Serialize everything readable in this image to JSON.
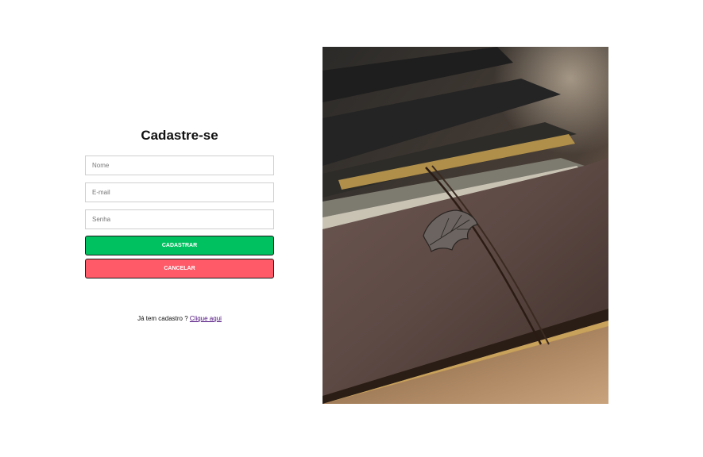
{
  "form": {
    "title": "Cadastre-se",
    "name_placeholder": "Nome",
    "email_placeholder": "E-mail",
    "password_placeholder": "Senha",
    "register_label": "CADASTRAR",
    "cancel_label": "CANCELAR"
  },
  "login": {
    "prompt": "Já tem cadastro ?",
    "link_label": "Clique aqui"
  },
  "hero": {
    "image_subject": "leather-journal-with-leaf-charm"
  },
  "colors": {
    "register": "#00c15f",
    "cancel": "#ff5a68",
    "link": "#4a0a7a"
  }
}
